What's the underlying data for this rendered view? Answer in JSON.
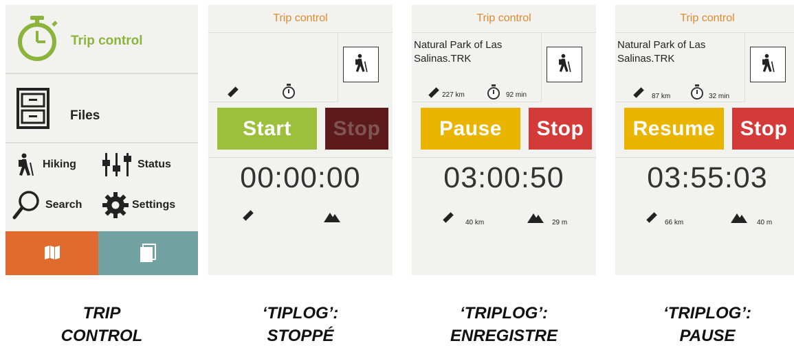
{
  "menu": {
    "trip_control": "Trip control",
    "files": "Files",
    "hiking": "Hiking",
    "status": "Status",
    "search": "Search",
    "settings": "Settings"
  },
  "screens": [
    {
      "title": "Trip control",
      "file_name": "",
      "distance_total": "",
      "time_total": "",
      "primary_button": "Start",
      "stop_button": "Stop",
      "timer": "00:00:00",
      "distance": "",
      "elevation": ""
    },
    {
      "title": "Trip control",
      "file_name_line1": "Natural Park of Las",
      "file_name_line2": "Salinas.TRK",
      "distance_total": "227 km",
      "time_total": "92 min",
      "primary_button": "Pause",
      "stop_button": "Stop",
      "timer": "03:00:50",
      "distance": "40 km",
      "elevation": "29 m"
    },
    {
      "title": "Trip control",
      "file_name_line1": "Natural Park of Las",
      "file_name_line2": "Salinas.TRK",
      "distance_total": "87 km",
      "time_total": "32 min",
      "primary_button": "Resume",
      "stop_button": "Stop",
      "timer": "03:55:03",
      "distance": "66 km",
      "elevation": "40 m"
    }
  ],
  "captions": [
    {
      "line1": "TRIP",
      "line2": "CONTROL"
    },
    {
      "line1": "‘TIPLOG’:",
      "line2": "STOPPÉ"
    },
    {
      "line1": "‘TRIPLOG’:",
      "line2": "ENREGISTRE"
    },
    {
      "line1": "‘TRIPLOG’:",
      "line2": "PAUSE"
    }
  ],
  "colors": {
    "accent_green": "#9cc03b",
    "title_orange": "#e2882e",
    "pause_yellow": "#e9b500",
    "stop_red": "#d43a37",
    "map_tile": "#e06b2e",
    "pages_tile": "#73a2a3"
  },
  "icons": [
    "stopwatch-icon",
    "file-cabinet-icon",
    "hiker-icon",
    "sliders-icon",
    "search-icon",
    "gear-icon",
    "map-icon",
    "pages-icon",
    "ruler-icon",
    "clock-icon",
    "mountain-icon"
  ]
}
